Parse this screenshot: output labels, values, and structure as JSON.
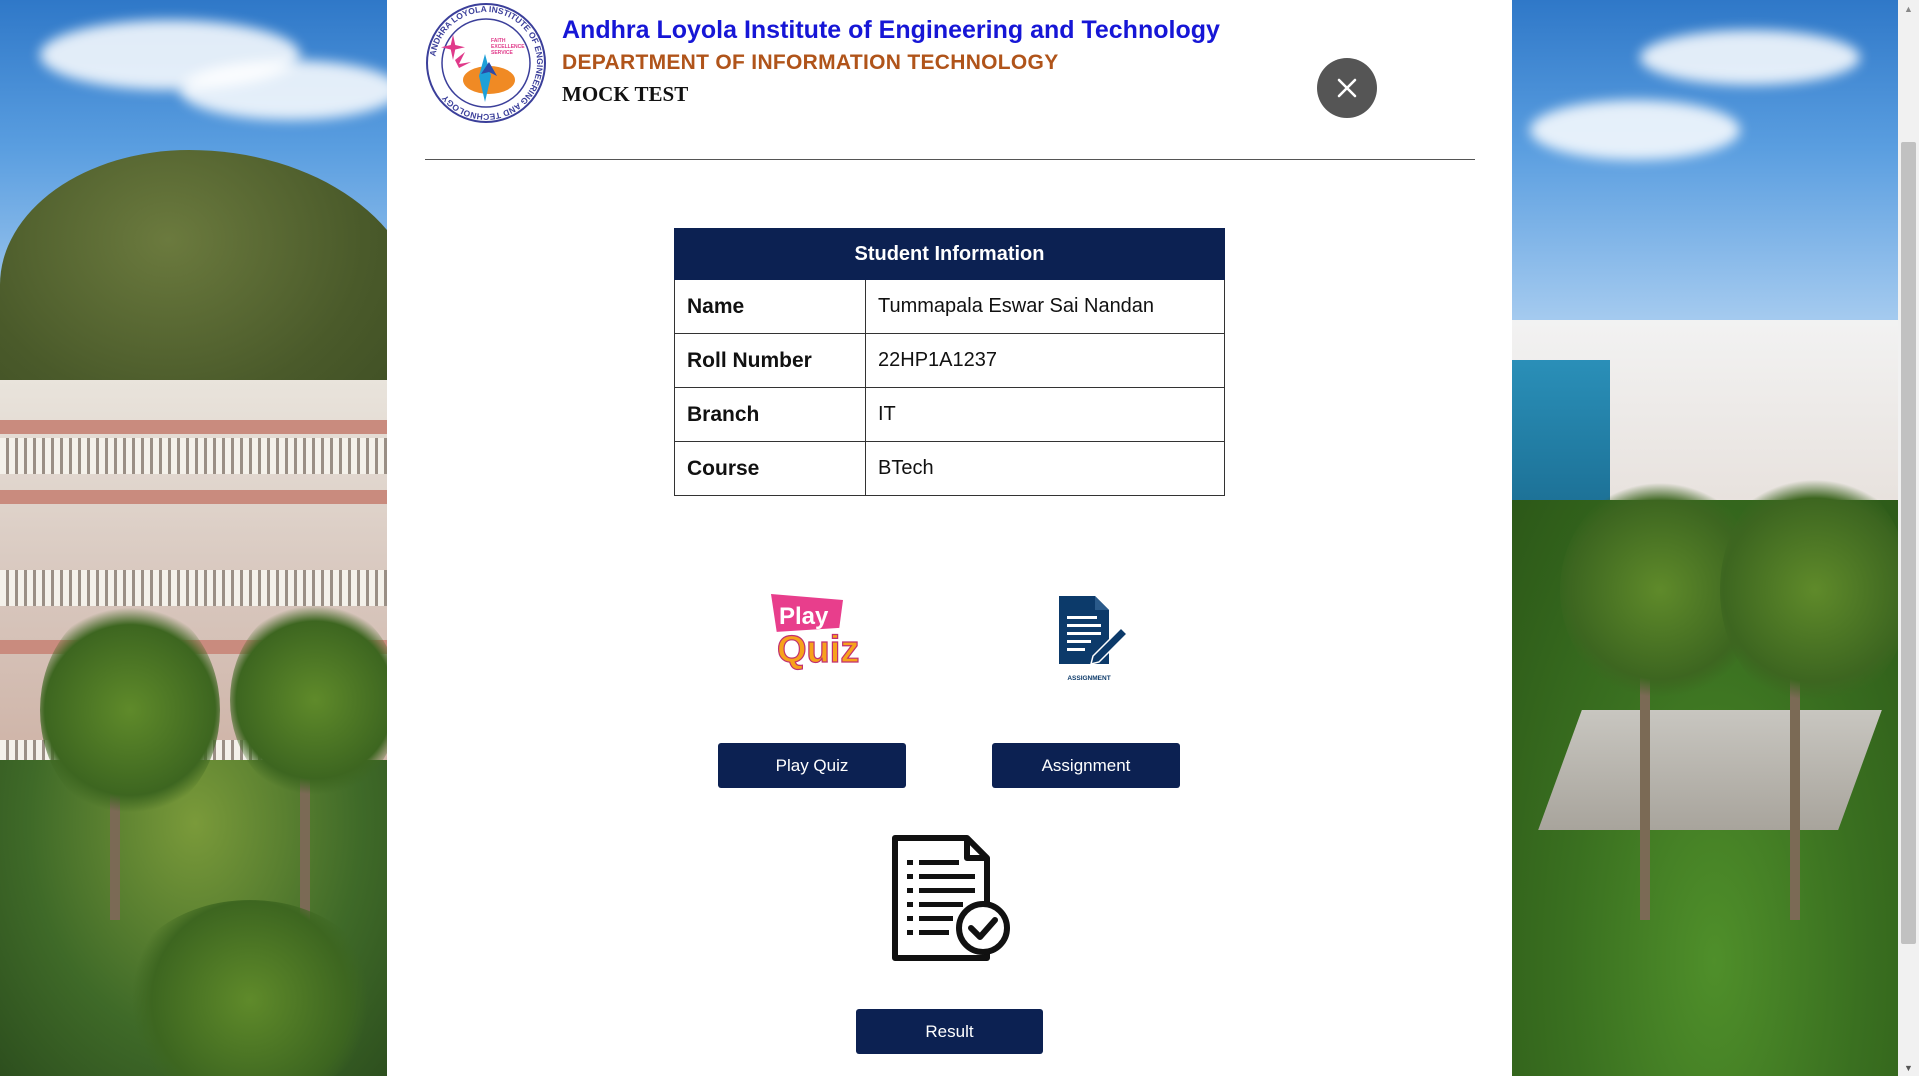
{
  "header": {
    "institute": "Andhra Loyola Institute of Engineering and Technology",
    "department": "DEPARTMENT OF INFORMATION TECHNOLOGY",
    "subtitle": "MOCK TEST",
    "logo_ring_text": "ANDHRA LOYOLA INSTITUTE OF ENGINEERING AND TECHNOLOGY",
    "logo_motto": [
      "FAITH",
      "EXCELLENCE",
      "SERVICE"
    ]
  },
  "student_info": {
    "title": "Student Information",
    "rows": [
      {
        "label": "Name",
        "value": "Tummapala Eswar Sai Nandan"
      },
      {
        "label": "Roll Number",
        "value": "22HP1A1237"
      },
      {
        "label": "Branch",
        "value": "IT"
      },
      {
        "label": "Course",
        "value": "BTech"
      }
    ]
  },
  "actions": {
    "quiz_icon_text": [
      "Play",
      "Quiz"
    ],
    "quiz_button": "Play Quiz",
    "assignment_icon_text": "ASSIGNMENT",
    "assignment_button": "Assignment",
    "result_button": "Result"
  },
  "overlay": {
    "close_symbol": "✕"
  },
  "colors": {
    "primary": "#0c2152",
    "institute_blue": "#1616d6",
    "department_orange": "#b0541a"
  },
  "icons": [
    "close-icon",
    "play-quiz-icon",
    "assignment-icon",
    "result-document-icon",
    "institute-logo"
  ]
}
